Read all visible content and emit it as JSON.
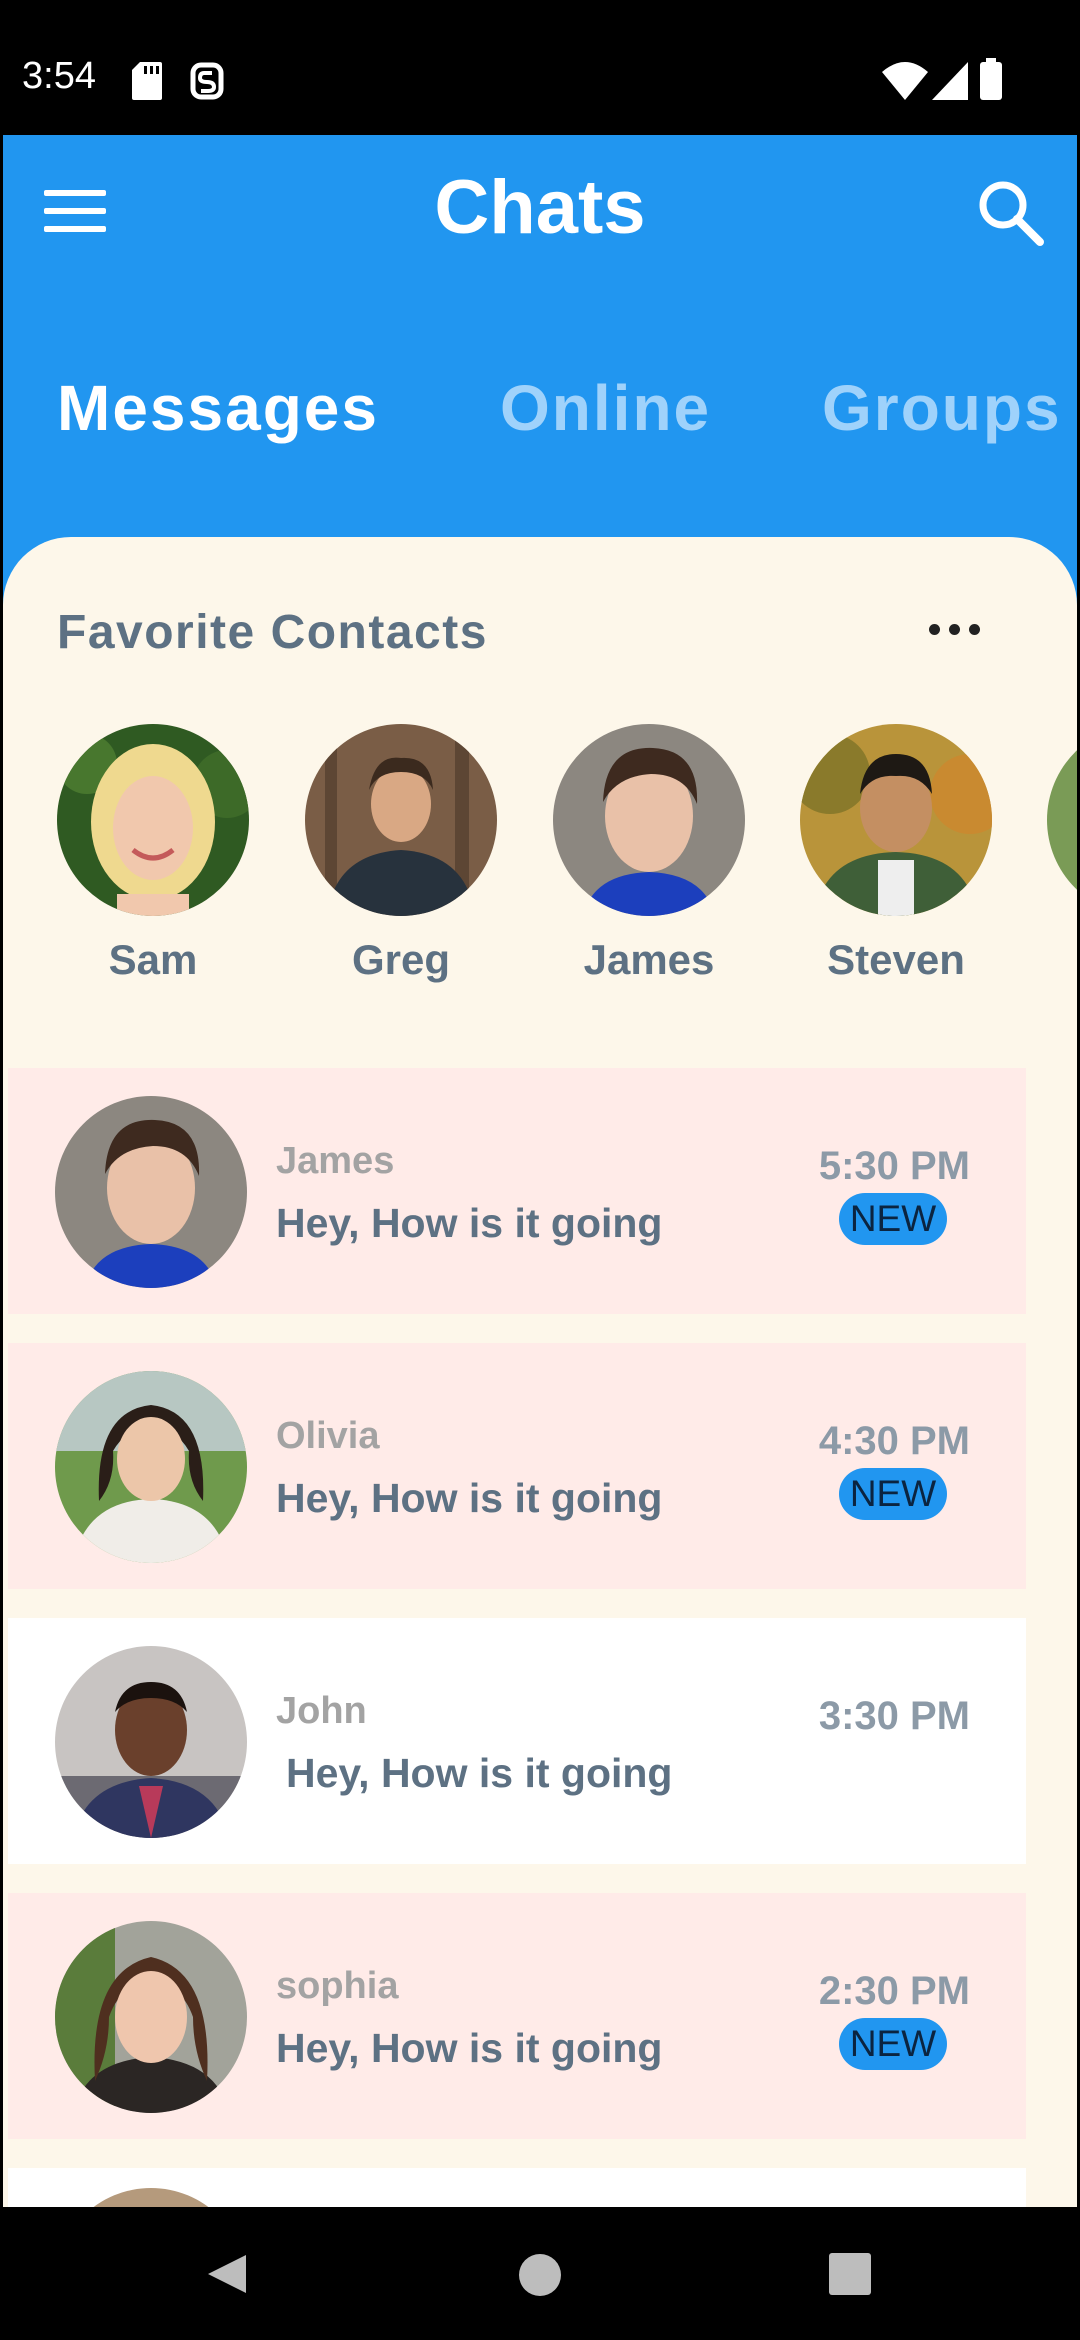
{
  "status_bar": {
    "time": "3:54",
    "icons": [
      "sd-card-icon",
      "notification-icon",
      "wifi-icon",
      "signal-icon",
      "battery-icon"
    ]
  },
  "header": {
    "title": "Chats",
    "menu_icon": "menu-icon",
    "search_icon": "search-icon",
    "tabs": [
      {
        "label": "Messages",
        "active": true
      },
      {
        "label": "Online",
        "active": false
      },
      {
        "label": "Groups",
        "active": false
      }
    ]
  },
  "favorites": {
    "title": "Favorite Contacts",
    "more_icon": "more-icon",
    "contacts": [
      {
        "name": "Sam"
      },
      {
        "name": "Greg"
      },
      {
        "name": "James"
      },
      {
        "name": "Steven"
      },
      {
        "name": ""
      }
    ]
  },
  "chats": [
    {
      "sender": "James",
      "preview": "Hey, How is it going",
      "time": "5:30 PM",
      "badge": "NEW",
      "unread": true
    },
    {
      "sender": "Olivia",
      "preview": "Hey, How is it going",
      "time": "4:30 PM",
      "badge": "NEW",
      "unread": true
    },
    {
      "sender": "John",
      "preview": "Hey, How is it going",
      "time": "3:30 PM",
      "badge": "",
      "unread": false
    },
    {
      "sender": "sophia",
      "preview": "Hey, How is it going",
      "time": "2:30 PM",
      "badge": "NEW",
      "unread": true
    }
  ],
  "colors": {
    "header_blue": "#2196F0",
    "panel_cream": "#FDF7EA",
    "unread_row": "#FFEBE8",
    "read_row": "#FFFFFF",
    "title_gray": "#5D7183",
    "inactive_tab": "#9FD2FB"
  },
  "nav": {
    "icons": [
      "back-icon",
      "home-icon",
      "recents-icon"
    ]
  }
}
